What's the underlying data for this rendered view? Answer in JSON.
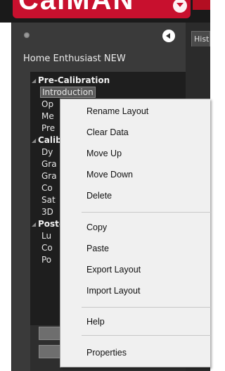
{
  "app": {
    "logo_text": "CalMAN"
  },
  "panel": {
    "layout_title": "Home Enthusiast NEW",
    "tree": [
      {
        "label": "Pre-Calibration",
        "group": true
      },
      {
        "label": "Introduction",
        "selected": true
      },
      {
        "label": "Op"
      },
      {
        "label": "Me"
      },
      {
        "label": "Pre"
      },
      {
        "label": "Calib",
        "group": true
      },
      {
        "label": "Dy"
      },
      {
        "label": "Gra"
      },
      {
        "label": "Gra"
      },
      {
        "label": "Co"
      },
      {
        "label": "Sat"
      },
      {
        "label": "3D"
      },
      {
        "label": "Post-",
        "group": true
      },
      {
        "label": "Lu"
      },
      {
        "label": "Co"
      },
      {
        "label": "Po"
      }
    ]
  },
  "tab": {
    "label": "Hist"
  },
  "context_menu": {
    "items": [
      "Rename Layout",
      "Clear Data",
      "Move Up",
      "Move Down",
      "Delete",
      "Copy",
      "Paste",
      "Export Layout",
      "Import Layout",
      "Help",
      "Properties"
    ]
  }
}
